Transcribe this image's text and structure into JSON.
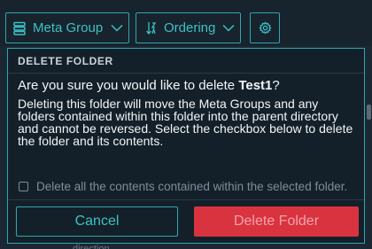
{
  "toolbar": {
    "meta_group_label": "Meta Group",
    "ordering_label": "Ordering"
  },
  "dialog": {
    "title": "DELETE FOLDER",
    "question_prefix": "Are you sure you would like to delete ",
    "folder_name": "Test1",
    "question_suffix": "?",
    "body": "Deleting this folder will move the Meta Groups and any folders contained within this folder into the parent directory and cannot be reversed. Select the checkbox below to delete the folder and its contents.",
    "checkbox_label": "Delete all the contents contained within the selected folder.",
    "checkbox_checked": false,
    "cancel_label": "Cancel",
    "delete_label": "Delete Folder"
  },
  "background": {
    "ghost_text": "direction"
  },
  "colors": {
    "accent": "#2fa6ad",
    "danger": "#d9333f",
    "panel": "#142029"
  },
  "icons": {
    "meta_group": "stack-icon",
    "ordering": "sort-icon",
    "settings": "gear-icon"
  }
}
